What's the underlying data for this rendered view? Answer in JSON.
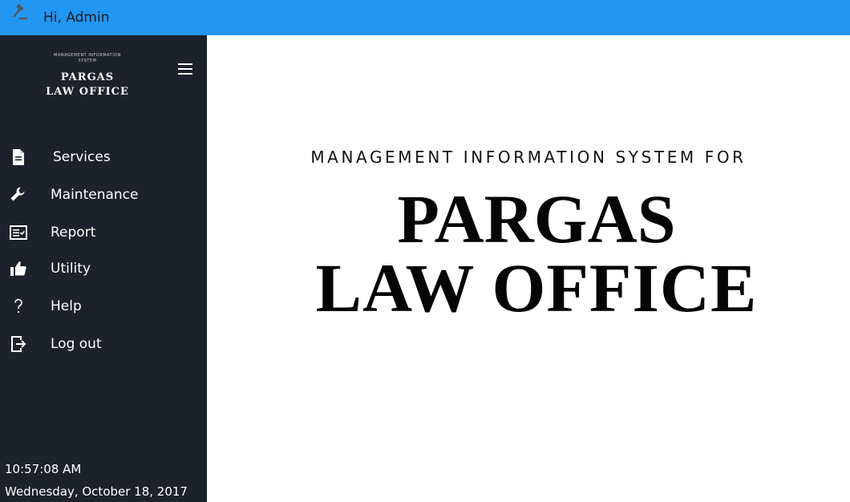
{
  "header": {
    "greeting": "Hi,  Admin",
    "icon": "gavel-icon",
    "background": "#2196F3"
  },
  "sidebar": {
    "background": "#1c212b",
    "logo": {
      "subtitle": "MANAGEMENT INFORMATION SYSTEM",
      "title_line1": "PARGAS",
      "title_line2": "LAW OFFICE"
    },
    "menu_icon": "hamburger-menu-icon",
    "items": [
      {
        "label": "Services",
        "icon": "document-icon"
      },
      {
        "label": "Maintenance",
        "icon": "wrench-icon"
      },
      {
        "label": "Report",
        "icon": "report-icon"
      },
      {
        "label": "Utility",
        "icon": "thumbs-up-icon"
      },
      {
        "label": "Help",
        "icon": "question-icon"
      },
      {
        "label": "Log out",
        "icon": "logout-icon"
      }
    ],
    "time": "10:57:08 AM",
    "date": "Wednesday, October 18, 2017"
  },
  "main": {
    "subtitle": "MANAGEMENT INFORMATION SYSTEM FOR",
    "title_line1": "PARGAS",
    "title_line2": "LAW OFFICE"
  }
}
